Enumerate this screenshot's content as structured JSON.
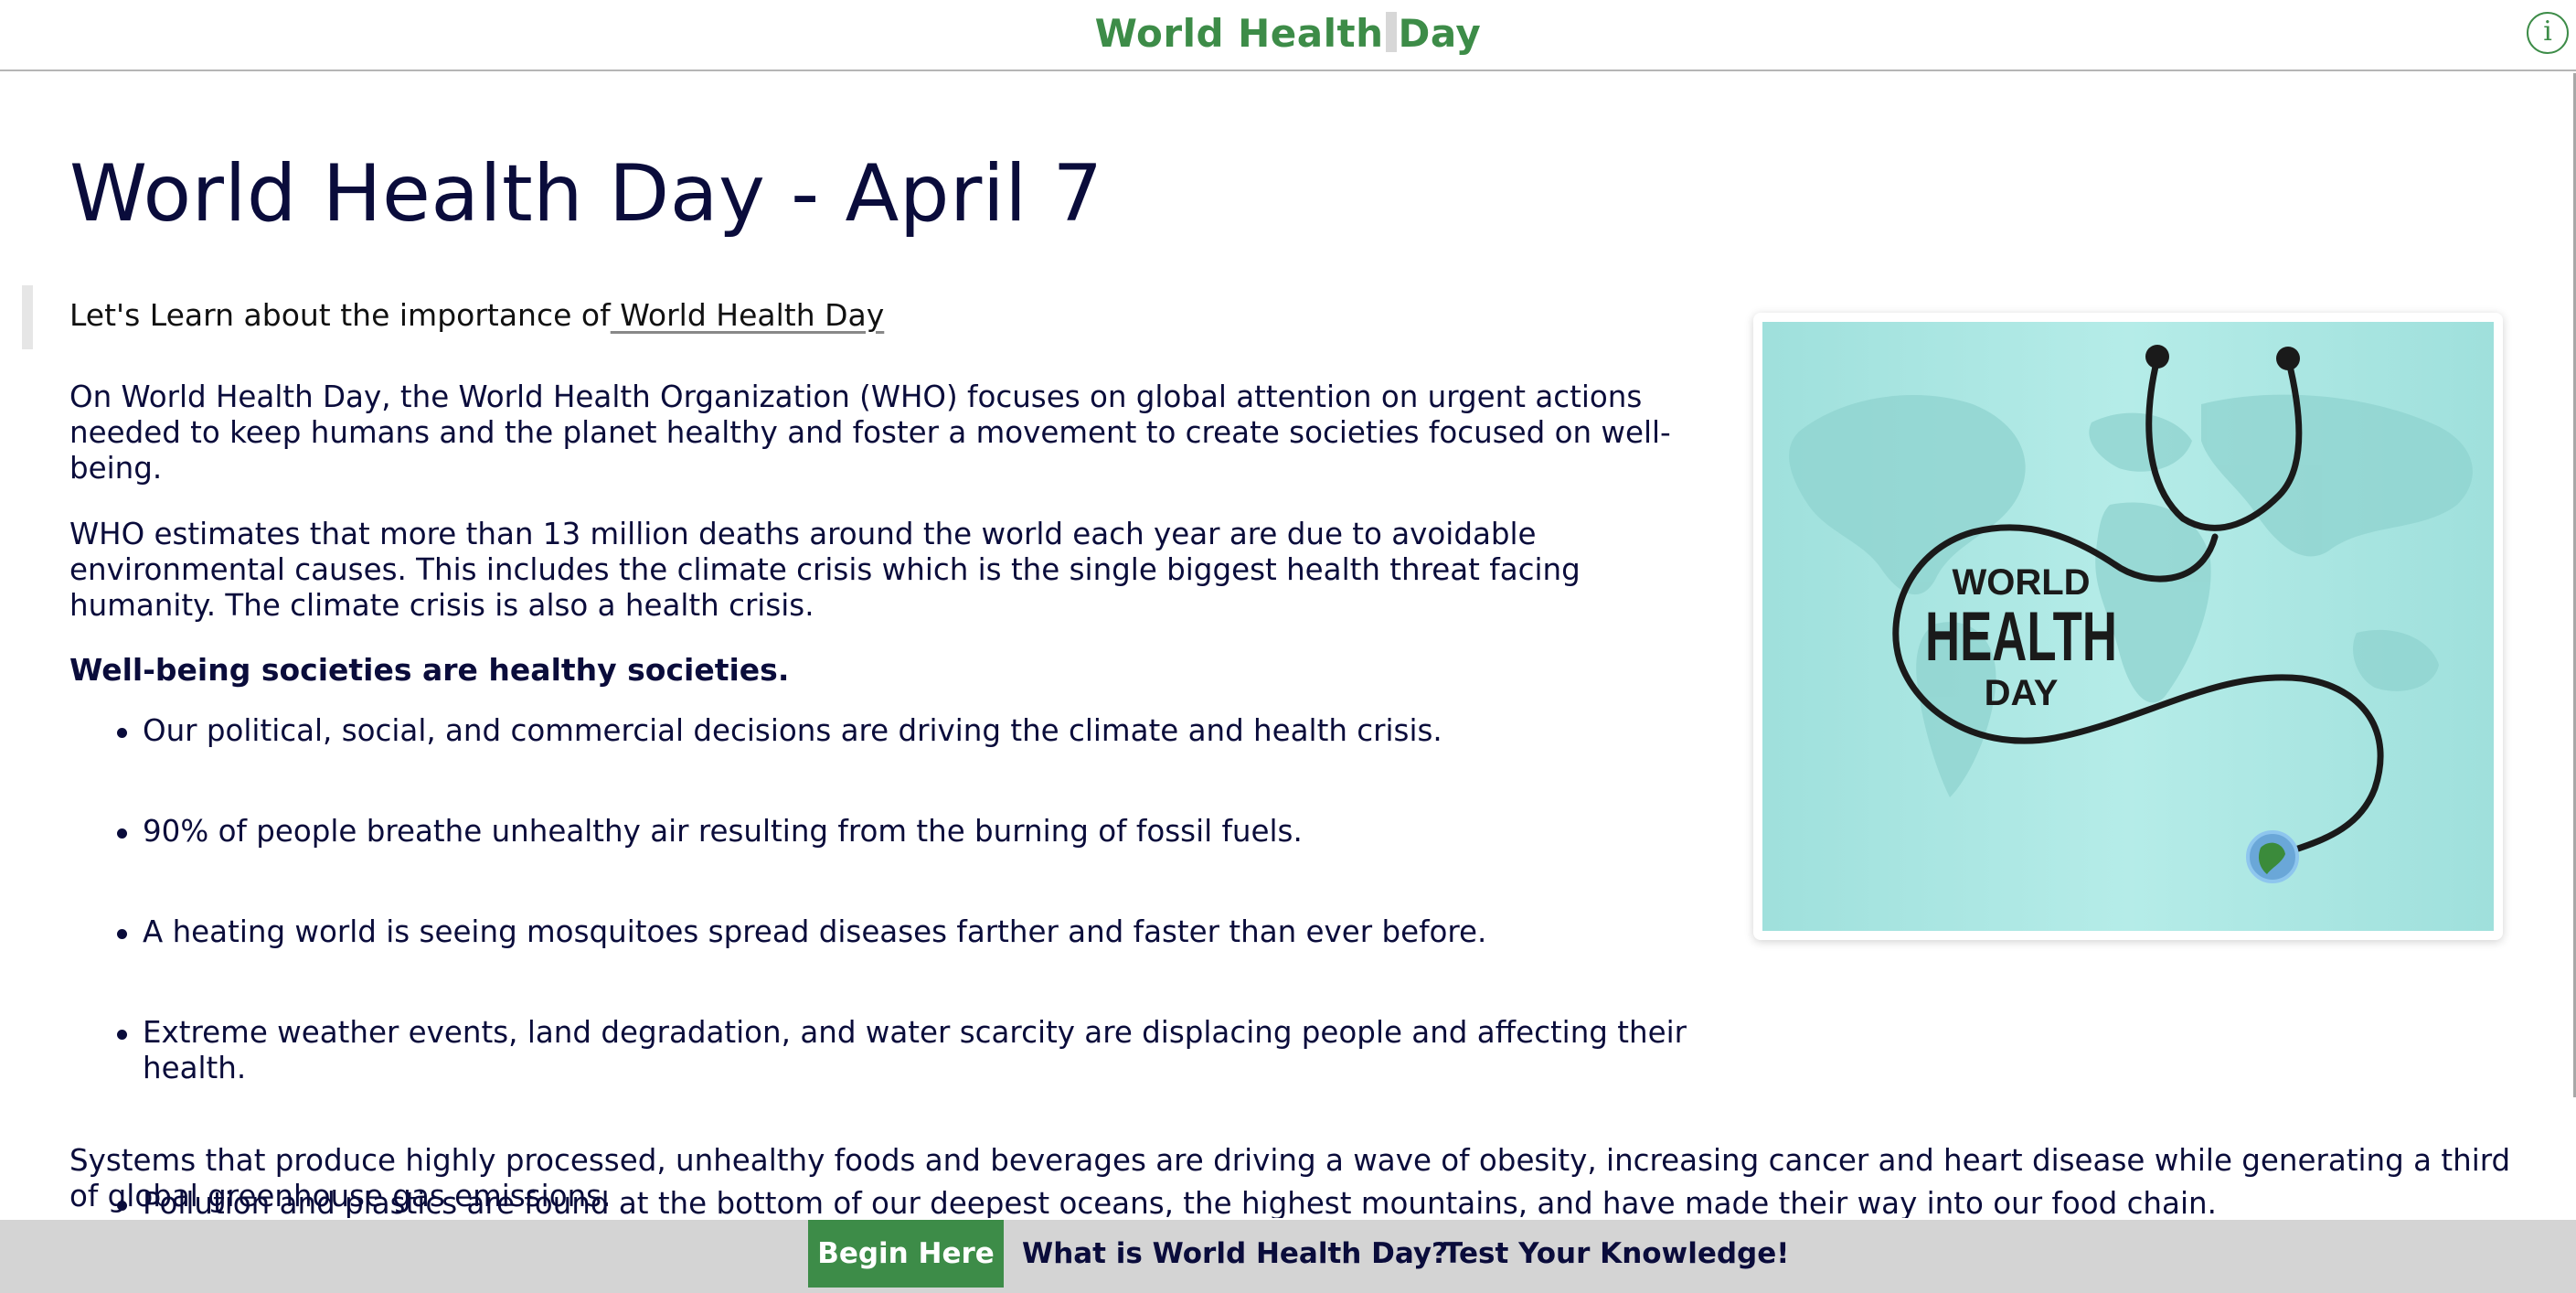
{
  "header": {
    "title_part1": "World Health",
    "title_part2": "Day",
    "info_icon": "info-icon",
    "accent_color": "#3d8c48"
  },
  "main": {
    "page_title": "World Health Day - April 7",
    "intro_text": "Let's Learn about the importance of",
    "intro_link": " World Health Day",
    "paragraph1": "On World Health Day, the World Health Organization (WHO) focuses on global attention on urgent actions needed to keep humans and the planet healthy and foster a movement to create societies focused on well-being.",
    "paragraph2": "WHO estimates that more than 13 million deaths around the world each year are due to avoidable environmental causes. This includes the climate crisis which is the single biggest health threat facing humanity. The climate crisis is also a health crisis.",
    "subheading": "Well-being societies are healthy societies.",
    "bullets": [
      "Our political, social, and commercial decisions are driving the climate and health crisis.",
      "90% of people breathe unhealthy air resulting from the burning of fossil fuels.",
      "A heating world is seeing mosquitoes spread diseases farther and faster than ever before.",
      "Extreme weather events, land degradation, and water scarcity are displacing people and affecting their health.",
      "Pollution and plastics are found at the bottom of our deepest oceans, the highest mountains, and have made their way into our food chain."
    ],
    "paragraph3": "Systems that produce highly processed, unhealthy foods and beverages are driving a wave of obesity, increasing cancer and heart disease while generating a third of global greenhouse gas emissions."
  },
  "image": {
    "line1": "WORLD",
    "line2": "HEALTH",
    "line3": "DAY",
    "background_color": "#a8e6e2"
  },
  "bottom_nav": {
    "begin": "Begin Here",
    "what": "What is World Health Day?",
    "test": "Test Your Knowledge!"
  }
}
